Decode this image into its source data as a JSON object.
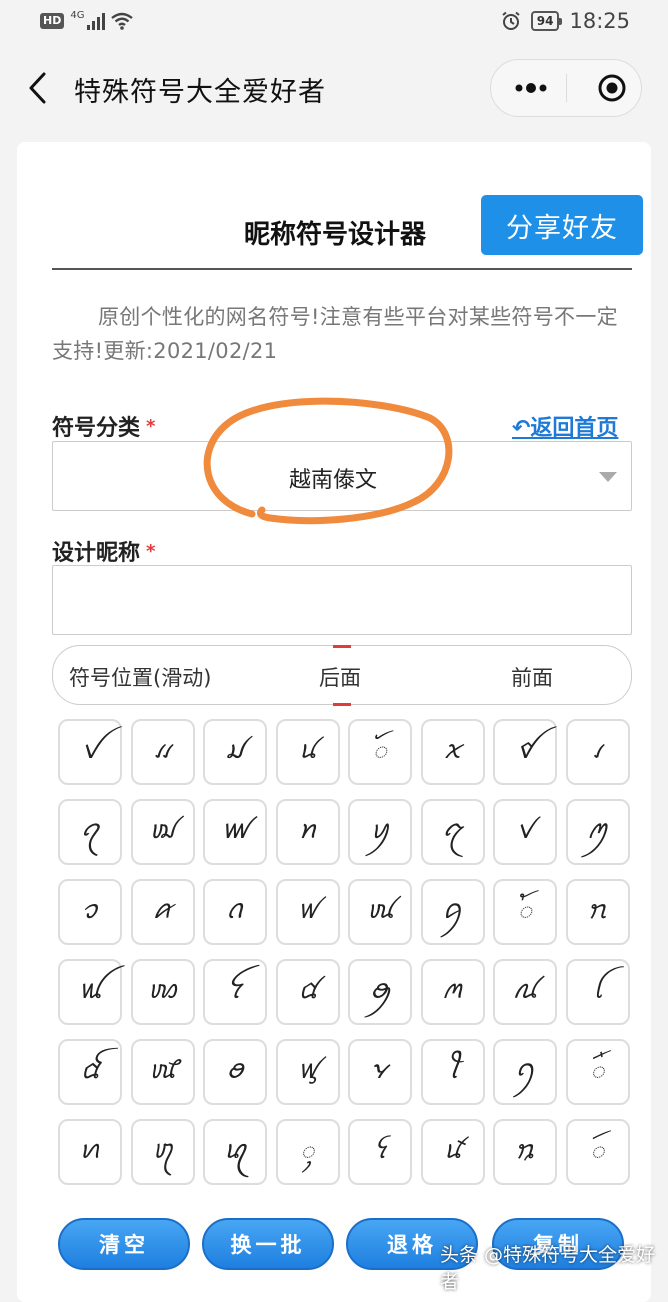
{
  "status_bar": {
    "hd": "HD",
    "network": "4G",
    "battery": "94",
    "time": "18:25"
  },
  "nav": {
    "title": "特殊符号大全爱好者"
  },
  "page": {
    "title": "昵称符号设计器",
    "share_button": "分享好友",
    "description": "原创个性化的网名符号!注意有些平台对某些符号不一定支持!更新:2021/02/21",
    "category_label": "符号分类",
    "required_mark": "*",
    "home_link": "↶返回首页",
    "category_value": "越南傣文",
    "nickname_label": "设计昵称",
    "nickname_value": "",
    "position": {
      "label": "符号位置(滑动)",
      "after": "后面",
      "before": "前面"
    }
  },
  "symbols": [
    "ꪜ",
    "ꪵ",
    "ꪣ",
    "ꪙ",
    "ꪰ",
    "ꪎ",
    "ꪤ",
    "ꪹ",
    "ꪖ",
    "ꪢ",
    "ꪛ",
    "ꪀ",
    "ꪗ",
    "ꪋ",
    "ꪚ",
    "ꪑ",
    "ꪫ",
    "ꪁ",
    "ꪒ",
    "ꪝ",
    "ꪘ",
    "ꪇ",
    "ꪳ",
    "ꪦ",
    "ꪡ",
    "ꪪ",
    "ꪼ",
    "ꪠ",
    "ꪯ",
    "ꪔ",
    "ꪄ",
    "ꪶ",
    "ꪞ",
    "ꪈ",
    "ꪮ",
    "ꪟ",
    "ꪩ",
    "ꪻ",
    "ꪆ",
    "ꪸ",
    "ꪕ",
    "ꪨ",
    "ꪓ",
    "ꪴ",
    "ꪺ",
    "ꪽ",
    "ꪧ",
    "ꪷ"
  ],
  "buttons": {
    "clear": "清空",
    "swap": "换一批",
    "backspace": "退格",
    "copy": "复制"
  },
  "watermark": "头条 @特殊符号大全爱好者",
  "colors": {
    "primary": "#1e90e8",
    "required": "#e23b3b",
    "highlight": "#f08a3c"
  }
}
